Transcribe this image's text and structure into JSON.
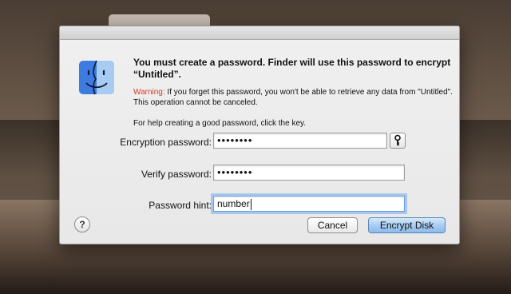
{
  "dialog": {
    "headline": "You must create a password. Finder will use this password to encrypt “Untitled”.",
    "warning_label": "Warning:",
    "warning_text": " If you forget this password, you won't be able to retrieve any data from \"Untitled\". This operation cannot be canceled.",
    "help_text": "For help creating a good password, click the key.",
    "fields": {
      "encryption_label": "Encryption password:",
      "encryption_value": "••••••••",
      "verify_label": "Verify password:",
      "verify_value": "••••••••",
      "hint_label": "Password hint:",
      "hint_value": "number"
    },
    "buttons": {
      "help": "?",
      "cancel": "Cancel",
      "encrypt": "Encrypt Disk"
    },
    "icons": {
      "app": "finder-icon",
      "key": "key-icon"
    },
    "colors": {
      "warning": "#d23a25",
      "default_button": "#a9cdf2",
      "focus_ring": "#a7c7ee"
    }
  }
}
